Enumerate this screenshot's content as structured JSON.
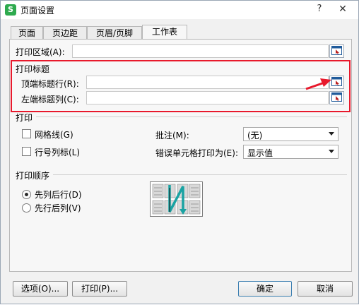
{
  "window": {
    "title": "页面设置",
    "icon_letter": "S",
    "help_glyph": "?",
    "close_glyph": "✕"
  },
  "tabs": [
    {
      "label": "页面"
    },
    {
      "label": "页边距"
    },
    {
      "label": "页眉/页脚"
    },
    {
      "label": "工作表",
      "active": true
    }
  ],
  "sheet": {
    "print_area_label": "打印区域(A):",
    "print_titles_heading": "打印标题",
    "top_rows_label": "顶端标题行(R):",
    "left_cols_label": "左端标题列(C):",
    "print_heading": "打印",
    "gridlines_label": "网格线(G)",
    "row_col_headers_label": "行号列标(L)",
    "comments_label": "批注(M):",
    "comments_value": "(无)",
    "errors_label": "错误单元格打印为(E):",
    "errors_value": "显示值",
    "order_heading": "打印顺序",
    "order_options": [
      {
        "label": "先列后行(D)",
        "selected": true
      },
      {
        "label": "先行后列(V)",
        "selected": false
      }
    ]
  },
  "footer": {
    "options_label": "选项(O)...",
    "print_label": "打印(P)...",
    "ok_label": "确定",
    "cancel_label": "取消"
  },
  "colors": {
    "highlight_box": "#e8192c",
    "annotation_arrow": "#e8192c",
    "app_icon": "#2eaa4e"
  },
  "icons": [
    "app-icon",
    "help-icon",
    "close-icon",
    "range-picker-icon",
    "dropdown-arrow-icon",
    "page-order-preview-icon",
    "annotation-arrow"
  ]
}
